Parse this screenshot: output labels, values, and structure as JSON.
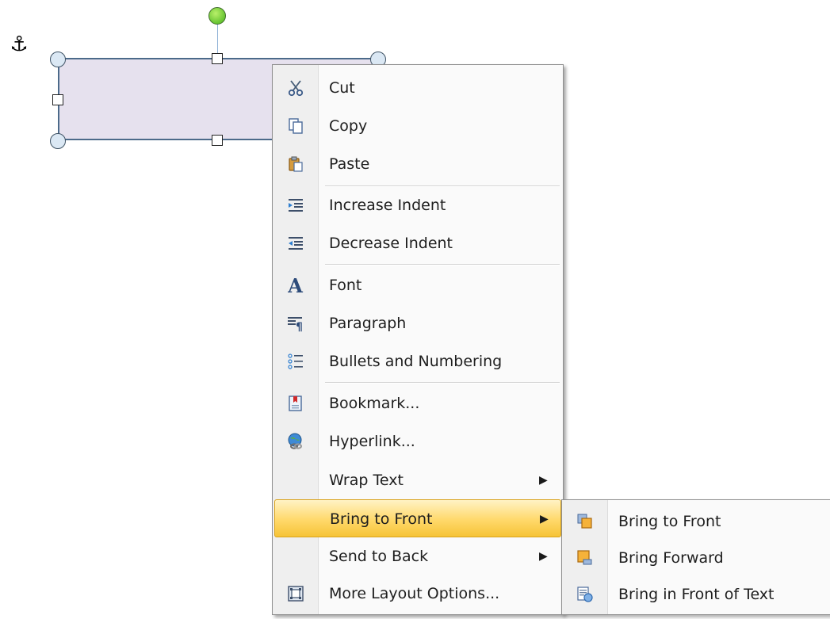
{
  "canvas": {
    "anchor_icon": "anchor-icon",
    "shape_fill": "#e6e1ee",
    "rotate_handle_color": "#45b21a"
  },
  "context_menu": {
    "items": [
      {
        "label": "Cut",
        "icon": "scissors-icon"
      },
      {
        "label": "Copy",
        "icon": "copy-icon"
      },
      {
        "label": "Paste",
        "icon": "paste-icon"
      },
      {
        "label": "Increase Indent",
        "icon": "increase-indent-icon"
      },
      {
        "label": "Decrease Indent",
        "icon": "decrease-indent-icon"
      },
      {
        "label": "Font",
        "icon": "font-icon"
      },
      {
        "label": "Paragraph",
        "icon": "paragraph-icon"
      },
      {
        "label": "Bullets and Numbering",
        "icon": "bullets-icon"
      },
      {
        "label": "Bookmark...",
        "icon": "bookmark-icon"
      },
      {
        "label": "Hyperlink...",
        "icon": "hyperlink-icon"
      },
      {
        "label": "Wrap Text",
        "has_submenu": true
      },
      {
        "label": "Bring to Front",
        "has_submenu": true,
        "highlighted": true
      },
      {
        "label": "Send to Back",
        "has_submenu": true
      },
      {
        "label": "More Layout Options...",
        "icon": "layout-options-icon"
      }
    ],
    "highlight_color": "#ffd86a"
  },
  "submenu": {
    "items": [
      {
        "label": "Bring to Front",
        "icon": "bring-to-front-icon"
      },
      {
        "label": "Bring Forward",
        "icon": "bring-forward-icon"
      },
      {
        "label": "Bring in Front of Text",
        "icon": "bring-in-front-of-text-icon"
      }
    ]
  }
}
